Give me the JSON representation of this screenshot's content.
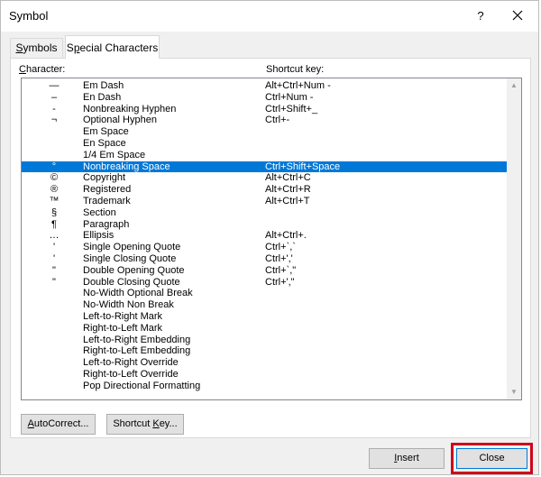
{
  "window": {
    "title": "Symbol",
    "help_label": "?"
  },
  "tabs": [
    {
      "label": "Symbols",
      "mnemonic": "S",
      "rest": "ymbols"
    },
    {
      "label": "Special Characters",
      "pre": "S",
      "mnemonic": "p",
      "rest": "ecial Characters"
    }
  ],
  "list": {
    "header_character": "Character:",
    "header_shortcut": "Shortcut key:",
    "selected_index": 7,
    "rows": [
      {
        "char": "—",
        "name": "Em Dash",
        "shortcut": "Alt+Ctrl+Num -"
      },
      {
        "char": "–",
        "name": "En Dash",
        "shortcut": "Ctrl+Num -"
      },
      {
        "char": "-",
        "name": "Nonbreaking Hyphen",
        "shortcut": "Ctrl+Shift+_"
      },
      {
        "char": "¬",
        "name": "Optional Hyphen",
        "shortcut": "Ctrl+-"
      },
      {
        "char": "",
        "name": "Em Space",
        "shortcut": ""
      },
      {
        "char": "",
        "name": "En Space",
        "shortcut": ""
      },
      {
        "char": "",
        "name": "1/4 Em Space",
        "shortcut": ""
      },
      {
        "char": "°",
        "name": "Nonbreaking Space",
        "shortcut": "Ctrl+Shift+Space"
      },
      {
        "char": "©",
        "name": "Copyright",
        "shortcut": "Alt+Ctrl+C"
      },
      {
        "char": "®",
        "name": "Registered",
        "shortcut": "Alt+Ctrl+R"
      },
      {
        "char": "™",
        "name": "Trademark",
        "shortcut": "Alt+Ctrl+T"
      },
      {
        "char": "§",
        "name": "Section",
        "shortcut": ""
      },
      {
        "char": "¶",
        "name": "Paragraph",
        "shortcut": ""
      },
      {
        "char": "…",
        "name": "Ellipsis",
        "shortcut": "Alt+Ctrl+."
      },
      {
        "char": "'",
        "name": "Single Opening Quote",
        "shortcut": "Ctrl+`,`"
      },
      {
        "char": "'",
        "name": "Single Closing Quote",
        "shortcut": "Ctrl+','"
      },
      {
        "char": "\"",
        "name": "Double Opening Quote",
        "shortcut": "Ctrl+`,\""
      },
      {
        "char": "\"",
        "name": "Double Closing Quote",
        "shortcut": "Ctrl+',\""
      },
      {
        "char": "",
        "name": "No-Width Optional Break",
        "shortcut": ""
      },
      {
        "char": "",
        "name": "No-Width Non Break",
        "shortcut": ""
      },
      {
        "char": "",
        "name": "Left-to-Right Mark",
        "shortcut": ""
      },
      {
        "char": "",
        "name": "Right-to-Left Mark",
        "shortcut": ""
      },
      {
        "char": "",
        "name": "Left-to-Right Embedding",
        "shortcut": ""
      },
      {
        "char": "",
        "name": "Right-to-Left Embedding",
        "shortcut": ""
      },
      {
        "char": "",
        "name": "Left-to-Right Override",
        "shortcut": ""
      },
      {
        "char": "",
        "name": "Right-to-Left Override",
        "shortcut": ""
      },
      {
        "char": "",
        "name": "Pop Directional Formatting",
        "shortcut": ""
      }
    ]
  },
  "buttons": {
    "autocorrect": {
      "mnemonic": "A",
      "rest": "utoCorrect..."
    },
    "shortcut": {
      "pre": "Shortcut ",
      "mnemonic": "K",
      "rest": "ey..."
    },
    "insert": {
      "mnemonic": "I",
      "rest": "nsert"
    },
    "close": "Close"
  },
  "colors": {
    "selection": "#0078d7",
    "highlight_box": "#d0021b"
  }
}
